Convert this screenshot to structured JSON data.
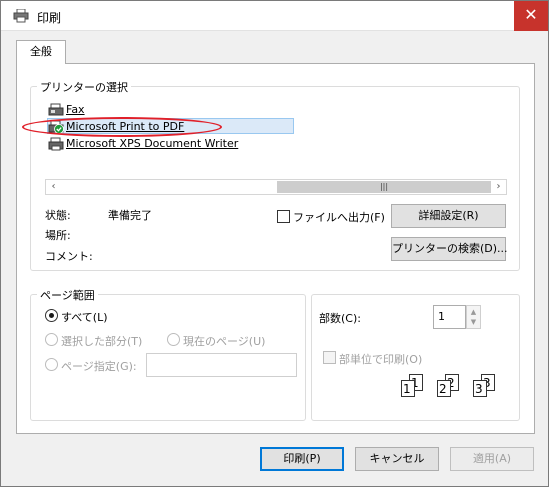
{
  "window": {
    "title": "印刷",
    "close_glyph": "✕"
  },
  "tabs": [
    {
      "label": "全般"
    }
  ],
  "printer_group": {
    "legend": "プリンターの選択",
    "printers": [
      {
        "label": "Fax",
        "icon": "fax-printer-icon"
      },
      {
        "label": "Microsoft Print to PDF",
        "icon": "default-printer-icon",
        "selected": true
      },
      {
        "label": "Microsoft XPS Document Writer",
        "icon": "printer-icon"
      }
    ],
    "status_label": "状態:",
    "status_value": "準備完了",
    "location_label": "場所:",
    "comment_label": "コメント:",
    "print_to_file_label": "ファイルへ出力(F)",
    "preferences_button": "詳細設定(R)",
    "find_printer_button": "プリンターの検索(D)...",
    "scroll_left": "‹",
    "scroll_right": "›",
    "scroll_thumb_grip": "|||"
  },
  "page_range_group": {
    "legend": "ページ範囲",
    "all_label": "すべて(L)",
    "selection_label": "選択した部分(T)",
    "current_page_label": "現在のページ(U)",
    "pages_label": "ページ指定(G):",
    "pages_value": ""
  },
  "copies_group": {
    "copies_label": "部数(C):",
    "copies_value": "1",
    "collate_label": "部単位で印刷(O)"
  },
  "footer": {
    "print_button": "印刷(P)",
    "cancel_button": "キャンセル",
    "apply_button": "適用(A)"
  },
  "colors": {
    "close_button": "#c7332c",
    "selection_highlight": "#dbe9f8",
    "annotation_ellipse": "#e0202a",
    "primary_border": "#0078d7"
  }
}
